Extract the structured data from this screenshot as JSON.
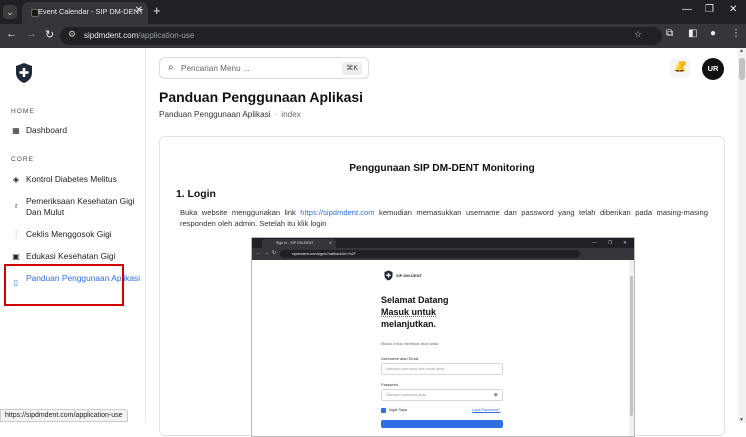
{
  "browser": {
    "tab_title": "Event Calendar - SIP DM-DENT",
    "tab_close": "✕",
    "new_tab": "+",
    "url_host": "sipdmdent.com",
    "url_path": "/application-use",
    "status_url": "https://sipdmdent.com/application-use"
  },
  "sidebar": {
    "home_header": "HOME",
    "core_header": "CORE",
    "items": [
      {
        "label": "Dashboard",
        "icon": "dashboard-icon"
      },
      {
        "label": "Kontrol Diabetes Melitus",
        "icon": "drop-icon"
      },
      {
        "label": "Pemeriksaan Kesehatan Gigi Dan Mulut",
        "icon": "tooth-icon"
      },
      {
        "label": "Ceklis Menggosok Gigi",
        "icon": "toothbrush-icon"
      },
      {
        "label": "Edukasi Kesehatan Gigi",
        "icon": "book-icon"
      },
      {
        "label": "Panduan Penggunaan Aplikasi",
        "icon": "phone-icon",
        "active": true
      }
    ]
  },
  "header": {
    "search_placeholder": "Pencarian Menu ...",
    "search_shortcut": "⌘K",
    "avatar_initials": "UR"
  },
  "main": {
    "page_title": "Panduan Penggunaan Aplikasi",
    "breadcrumb_parent": "Panduan Penggunaan Aplikasi",
    "breadcrumb_current": "index",
    "card_title": "Penggunaan SIP DM-DENT Monitoring",
    "section_heading": "1. Login",
    "para_before": "Buka website menggunakan link ",
    "para_link": "https://sipdmdent.com",
    "para_after": " kemudian memasukkan username dan password yang telah diberikan pada masing-masing responden oleh admin. Setelah itu klik login"
  },
  "screenshot": {
    "tab_title": "Sign In - SIP DM-DENT",
    "url": "sipdmdent.com/signin?callbackUrl=%2F",
    "logo_text": "SIP DM-DENT",
    "welcome_line1": "Selamat Datang",
    "welcome_line2": "Masuk untuk",
    "welcome_line3": "melanjutkan.",
    "subtitle": "Masuk untuk membuat akun anda",
    "username_label": "Username atau Email",
    "username_placeholder": "Masukan username atau email anda",
    "password_label": "Password",
    "password_placeholder": "Masukan password anda",
    "remember_label": "Ingat Saya",
    "forgot_link": "Lupa Password?"
  },
  "colors": {
    "accent": "#2f6fe4",
    "highlight_border": "#d30000",
    "notification_dot": "#f6b21a"
  }
}
